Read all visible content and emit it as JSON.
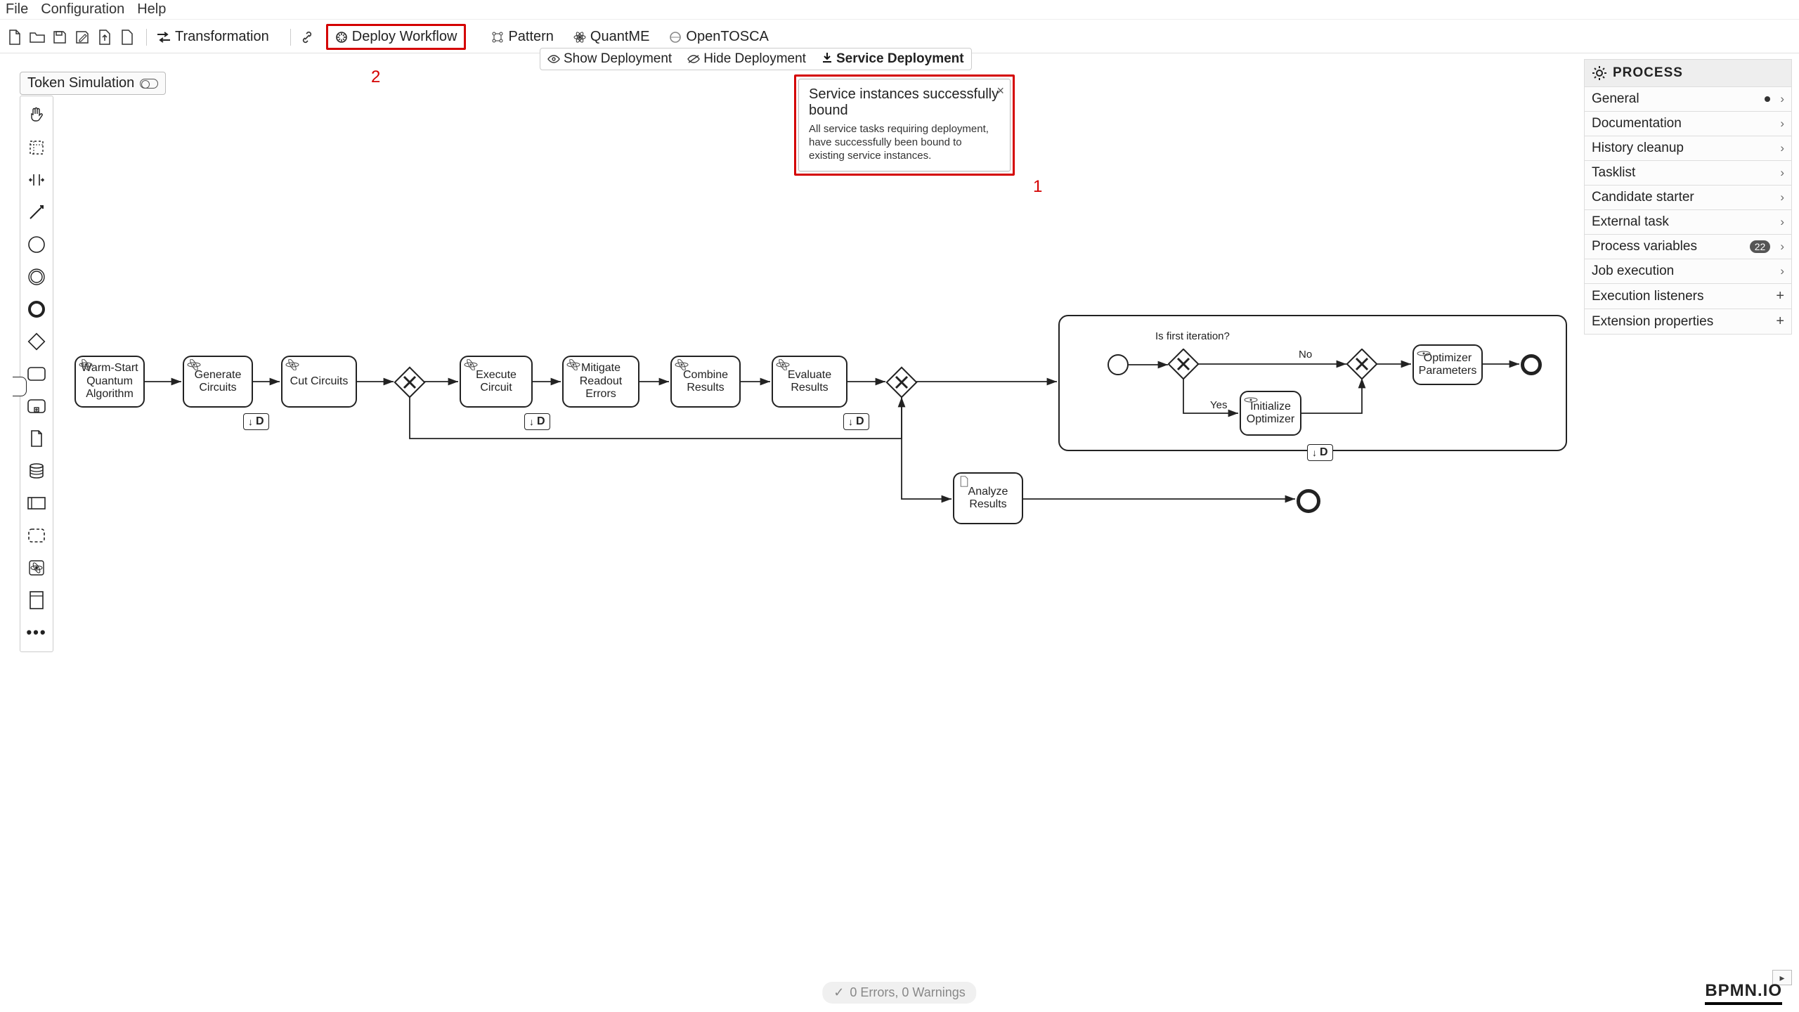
{
  "menu": {
    "file": "File",
    "configuration": "Configuration",
    "help": "Help"
  },
  "toolbar": {
    "transformation": "Transformation",
    "deploy_workflow": "Deploy Workflow",
    "pattern": "Pattern",
    "quantme": "QuantME",
    "opentosca": "OpenTOSCA"
  },
  "subtoolbar": {
    "show": "Show Deployment",
    "hide": "Hide Deployment",
    "service": "Service Deployment"
  },
  "token_simulation": "Token Simulation",
  "annotations": {
    "one": "1",
    "two": "2"
  },
  "notif": {
    "title": "Service instances successfully bound",
    "body": "All service tasks requiring deployment, have successfully been bound to existing service instances."
  },
  "tasks": {
    "warm": "Warm-Start Quantum Algorithm",
    "gen": "Generate Circuits",
    "cut": "Cut Circuits",
    "exec": "Execute Circuit",
    "mitigate": "Mitigate Readout Errors",
    "combine": "Combine Results",
    "evaluate": "Evaluate Results",
    "optparams": "Optimizer Parameters",
    "initopt": "Initialize Optimizer",
    "analyze": "Analyze Results"
  },
  "labels": {
    "isfirst": "Is first iteration?",
    "yes": "Yes",
    "no": "No",
    "d": "D"
  },
  "rightpanel": {
    "header": "PROCESS",
    "rows": {
      "general": "General",
      "documentation": "Documentation",
      "history": "History cleanup",
      "tasklist": "Tasklist",
      "candidate": "Candidate starter",
      "external": "External task",
      "processvars": "Process variables",
      "jobexec": "Job execution",
      "execlisteners": "Execution listeners",
      "extprops": "Extension properties"
    },
    "processvars_count": "22"
  },
  "status": "0 Errors, 0 Warnings",
  "logo": "BPMN.IO"
}
